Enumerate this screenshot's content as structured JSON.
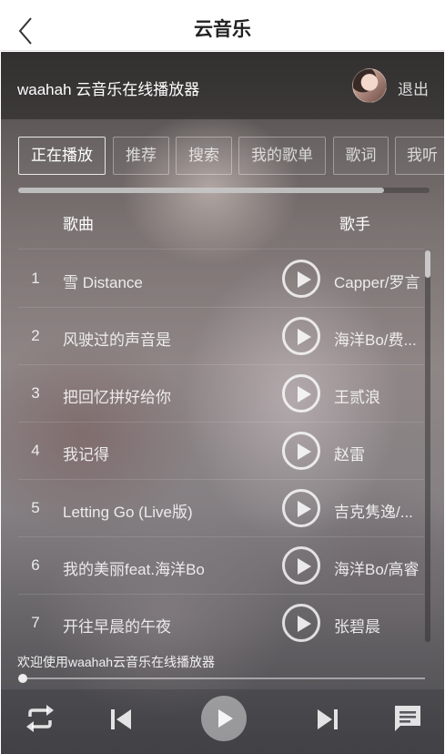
{
  "nav": {
    "title": "云音乐"
  },
  "topbar": {
    "app_title": "waahah 云音乐在线播放器",
    "logout_label": "退出"
  },
  "tabs": [
    {
      "label": "正在播放",
      "active": true
    },
    {
      "label": "推荐",
      "active": false
    },
    {
      "label": "搜索",
      "active": false
    },
    {
      "label": "我的歌单",
      "active": false
    },
    {
      "label": "歌词",
      "active": false
    },
    {
      "label": "我听",
      "active": false
    }
  ],
  "list": {
    "header": {
      "song": "歌曲",
      "artist": "歌手"
    },
    "rows": [
      {
        "num": "1",
        "song": "雪 Distance",
        "artist": "Capper/罗言"
      },
      {
        "num": "2",
        "song": "风驶过的声音是",
        "artist": "海洋Bo/费..."
      },
      {
        "num": "3",
        "song": "把回忆拼好给你",
        "artist": "王贰浪"
      },
      {
        "num": "4",
        "song": "我记得",
        "artist": "赵雷"
      },
      {
        "num": "5",
        "song": "Letting Go (Live版)",
        "artist": "吉克隽逸/..."
      },
      {
        "num": "6",
        "song": "我的美丽feat.海洋Bo",
        "artist": "海洋Bo/高睿"
      },
      {
        "num": "7",
        "song": "开往早晨的午夜",
        "artist": "张碧晨"
      }
    ]
  },
  "status": {
    "message": "欢迎使用waahah云音乐在线播放器",
    "progress": 0
  },
  "icons": {
    "back": "chevron-left-icon",
    "repeat": "repeat-icon",
    "prev": "skip-previous-icon",
    "play": "play-icon",
    "next": "skip-next-icon",
    "comment": "comment-icon"
  }
}
